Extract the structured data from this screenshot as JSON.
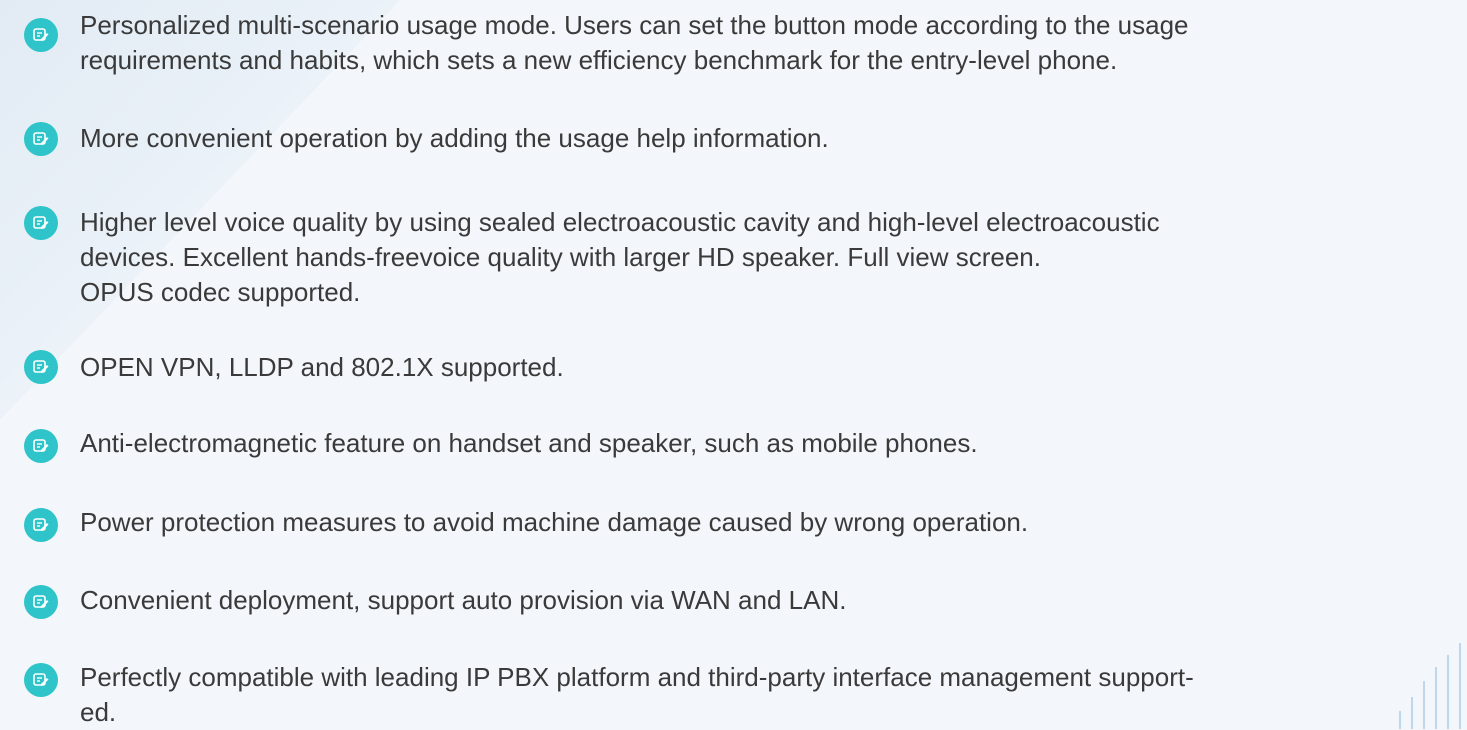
{
  "features": [
    {
      "text": "Personalized multi-scenario usage mode. Users can set the button mode according to the usage\nrequirements and habits, which sets a new efficiency benchmark for the entry-level phone.",
      "icon": "note-pen-icon"
    },
    {
      "text": "More convenient operation by adding the usage help information.",
      "icon": "note-pen-icon"
    },
    {
      "text": "Higher level voice quality by using sealed electroacoustic cavity and high-level electroacoustic\ndevices. Excellent hands-freevoice quality with larger HD speaker. Full view screen.\nOPUS codec supported.",
      "icon": "note-pen-icon"
    },
    {
      "text": "OPEN VPN, LLDP and 802.1X supported.",
      "icon": "note-pen-icon"
    },
    {
      "text": "Anti-electromagnetic feature on handset and speaker, such as mobile phones.",
      "icon": "note-pen-icon"
    },
    {
      "text": "Power protection measures to avoid machine damage caused by wrong operation.",
      "icon": "note-pen-icon"
    },
    {
      "text": "Convenient deployment, support auto provision via WAN and LAN.",
      "icon": "note-pen-icon"
    },
    {
      "text": "Perfectly compatible with leading IP PBX platform and third-party interface management support-\ned.",
      "icon": "note-pen-icon"
    }
  ],
  "colors": {
    "icon_bg": "#2ec4c9",
    "text": "#3a3a3a",
    "background": "#f3f7fb"
  }
}
